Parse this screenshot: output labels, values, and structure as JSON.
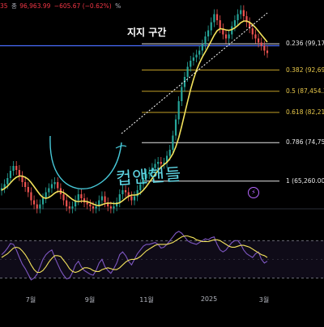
{
  "header": {
    "prefix": "35",
    "last_label": "종",
    "last_value": "96,963.99",
    "change": "−605.67 (−0.62%)",
    "tail": "%"
  },
  "annotations": {
    "support_zone": "지지 구간",
    "handwritten": "컵앤핸들"
  },
  "icons": {
    "bolt": "lightning-bolt-icon"
  },
  "colors": {
    "background": "#000000",
    "up": "#26a69a",
    "down": "#ef5350",
    "ma": "#f3e25c",
    "rsi": "#7e57c2",
    "rsi_ma": "#f3e25c",
    "fib_gold": "#d6b02c",
    "fib_white": "#ffffff",
    "support": "#4a6cff",
    "trendline": "#ffffff",
    "cup": "#47c8d8"
  },
  "chart_data": {
    "type": "candlestick",
    "x_labels": [
      "7월",
      "9월",
      "11월",
      "2025",
      "3월"
    ],
    "price_range": [
      60000,
      110000
    ],
    "fib_levels": [
      {
        "ratio": "0.236",
        "price": 99173,
        "label": "0.236 (99,173"
      },
      {
        "ratio": "0.382",
        "price": 92692,
        "label": "0.382 (92,692"
      },
      {
        "ratio": "0.5",
        "price": 87454,
        "label": "0.5 (87,454.39"
      },
      {
        "ratio": "0.618",
        "price": 82216,
        "label": "0.618 (82,216"
      },
      {
        "ratio": "0.786",
        "price": 74759,
        "label": "0.786 (74,759"
      },
      {
        "ratio": "1",
        "price": 65260,
        "label": "1 (65,260.00)"
      }
    ],
    "support_price": 98700,
    "close_series": [
      63500,
      64500,
      66000,
      67800,
      69000,
      68000,
      66500,
      65000,
      63800,
      62500,
      60500,
      59500,
      58500,
      59500,
      61000,
      62500,
      63500,
      64500,
      65000,
      63500,
      62000,
      60500,
      59000,
      58500,
      59000,
      60500,
      62000,
      61000,
      60000,
      59500,
      59000,
      58500,
      59000,
      60500,
      61500,
      60000,
      59000,
      58500,
      59000,
      60000,
      62000,
      63000,
      62500,
      61500,
      60500,
      61500,
      63000,
      64500,
      66000,
      67000,
      67500,
      68500,
      69500,
      70000,
      69500,
      69800,
      71500,
      73000,
      76500,
      80500,
      85000,
      88500,
      91000,
      93500,
      95000,
      95800,
      96500,
      97500,
      99000,
      101000,
      102500,
      104500,
      106500,
      105000,
      103000,
      101500,
      100500,
      101500,
      103500,
      105000,
      106500,
      107500,
      106000,
      104500,
      103000,
      101500,
      100500,
      99500,
      98700,
      97500,
      96900
    ],
    "moving_average": [
      63000,
      63400,
      64000,
      64800,
      65600,
      66200,
      66500,
      66500,
      66200,
      65700,
      64900,
      63900,
      62900,
      61900,
      61200,
      61000,
      61200,
      61700,
      62300,
      62700,
      62700,
      62400,
      61900,
      61300,
      60700,
      60300,
      60200,
      60300,
      60300,
      60200,
      59900,
      59600,
      59300,
      59200,
      59400,
      59700,
      59800,
      59800,
      59700,
      59700,
      59900,
      60400,
      61000,
      61500,
      61800,
      61800,
      61900,
      62300,
      63000,
      63900,
      64900,
      65900,
      66900,
      67900,
      68700,
      69300,
      69900,
      70800,
      72000,
      73700,
      76000,
      78800,
      81900,
      84900,
      87800,
      90400,
      92600,
      94400,
      95900,
      97200,
      98500,
      99900,
      101300,
      102400,
      102900,
      102800,
      102600,
      102500,
      102700,
      103100,
      103700,
      104400,
      104800,
      104800,
      104500,
      103900,
      103200,
      102300,
      101400,
      100500,
      99600
    ],
    "rsi": {
      "range": [
        20,
        85
      ],
      "overbought": 70,
      "oversold": 30,
      "values": [
        55,
        58,
        62,
        67,
        66,
        60,
        52,
        45,
        40,
        34,
        28,
        30,
        34,
        42,
        50,
        55,
        58,
        60,
        52,
        45,
        38,
        33,
        29,
        30,
        36,
        44,
        48,
        42,
        38,
        36,
        34,
        33,
        38,
        46,
        50,
        42,
        38,
        35,
        40,
        46,
        55,
        58,
        54,
        48,
        44,
        50,
        56,
        60,
        64,
        66,
        66,
        67,
        68,
        66,
        62,
        63,
        66,
        70,
        74,
        78,
        80,
        78,
        74,
        70,
        68,
        67,
        66,
        68,
        70,
        72,
        71,
        73,
        74,
        66,
        60,
        58,
        60,
        64,
        68,
        70,
        70,
        66,
        60,
        56,
        54,
        52,
        56,
        58,
        50,
        46,
        48
      ],
      "ma": [
        52,
        54,
        56,
        59,
        62,
        63,
        62,
        59,
        55,
        50,
        44,
        39,
        36,
        36,
        38,
        42,
        47,
        51,
        54,
        54,
        53,
        49,
        45,
        40,
        37,
        36,
        37,
        39,
        41,
        41,
        40,
        38,
        37,
        37,
        39,
        40,
        41,
        40,
        39,
        39,
        41,
        44,
        47,
        49,
        50,
        50,
        51,
        53,
        56,
        59,
        61,
        63,
        65,
        66,
        66,
        66,
        66,
        67,
        68,
        70,
        72,
        74,
        75,
        75,
        74,
        73,
        71,
        70,
        69,
        69,
        69,
        70,
        71,
        71,
        70,
        68,
        66,
        64,
        63,
        63,
        64,
        65,
        65,
        64,
        63,
        61,
        59,
        57,
        55,
        54,
        52
      ]
    }
  }
}
